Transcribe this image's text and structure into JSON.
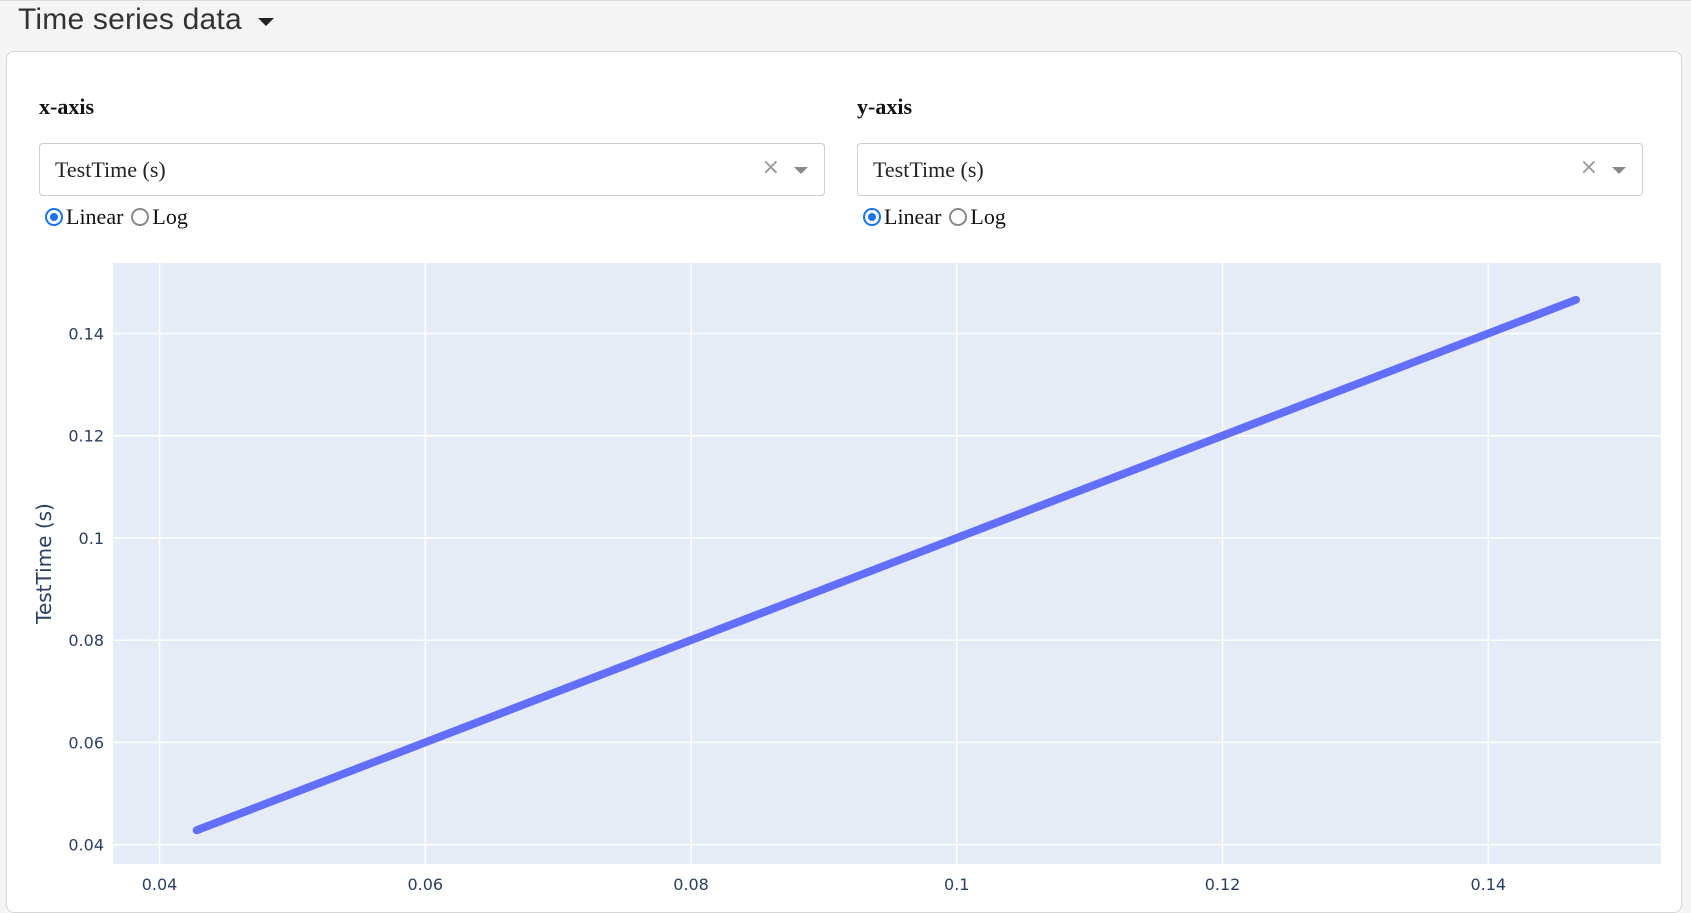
{
  "header": {
    "title": "Time series data",
    "toggle_icon": "caret-down-icon"
  },
  "x_axis": {
    "heading": "x-axis",
    "selected": "TestTime (s)",
    "clear_icon": "×",
    "scale_options": [
      "Linear",
      "Log"
    ],
    "selected_scale": "Linear"
  },
  "y_axis": {
    "heading": "y-axis",
    "selected": "TestTime (s)",
    "clear_icon": "×",
    "scale_options": [
      "Linear",
      "Log"
    ],
    "selected_scale": "Linear"
  },
  "colors": {
    "plot_bg": "#e5ecf6",
    "line": "#636efa",
    "grid": "#ffffff",
    "accent": "#1a73e8"
  },
  "chart_data": {
    "type": "line",
    "xlabel": "",
    "ylabel": "TestTime (s)",
    "xlim": [
      0.0365,
      0.153
    ],
    "ylim": [
      0.0362,
      0.1538
    ],
    "xticks": [
      0.04,
      0.06,
      0.08,
      0.1,
      0.12,
      0.14
    ],
    "xtick_labels": [
      "0.04",
      "0.06",
      "0.08",
      "0.1",
      "0.12",
      "0.14"
    ],
    "yticks": [
      0.04,
      0.06,
      0.08,
      0.1,
      0.12,
      0.14
    ],
    "ytick_labels": [
      "0.04",
      "0.06",
      "0.08",
      "0.1",
      "0.12",
      "0.14"
    ],
    "grid": true,
    "series": [
      {
        "x": [
          0.0428,
          0.1466
        ],
        "y": [
          0.0428,
          0.1466
        ]
      }
    ]
  }
}
